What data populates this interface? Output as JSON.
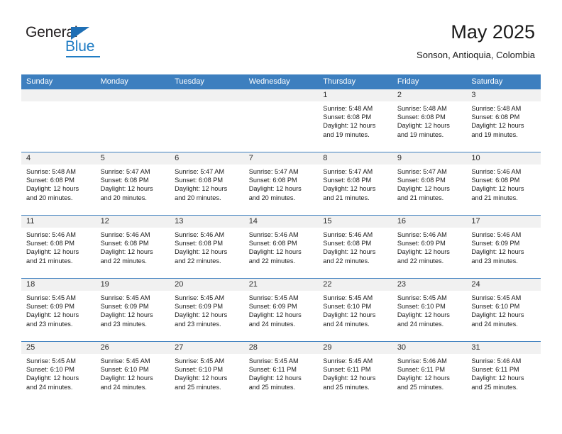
{
  "brand": {
    "name_part1": "General",
    "name_part2": "Blue",
    "accent_color": "#1f7cc4"
  },
  "header": {
    "title": "May 2025",
    "subtitle": "Sonson, Antioquia, Colombia"
  },
  "calendar": {
    "header_bg": "#3d7fbf",
    "daynum_bg": "#f1f1f1",
    "weekdays": [
      "Sunday",
      "Monday",
      "Tuesday",
      "Wednesday",
      "Thursday",
      "Friday",
      "Saturday"
    ],
    "weeks": [
      [
        {
          "day": "",
          "lines": []
        },
        {
          "day": "",
          "lines": []
        },
        {
          "day": "",
          "lines": []
        },
        {
          "day": "",
          "lines": []
        },
        {
          "day": "1",
          "lines": [
            "Sunrise: 5:48 AM",
            "Sunset: 6:08 PM",
            "Daylight: 12 hours",
            "and 19 minutes."
          ]
        },
        {
          "day": "2",
          "lines": [
            "Sunrise: 5:48 AM",
            "Sunset: 6:08 PM",
            "Daylight: 12 hours",
            "and 19 minutes."
          ]
        },
        {
          "day": "3",
          "lines": [
            "Sunrise: 5:48 AM",
            "Sunset: 6:08 PM",
            "Daylight: 12 hours",
            "and 19 minutes."
          ]
        }
      ],
      [
        {
          "day": "4",
          "lines": [
            "Sunrise: 5:48 AM",
            "Sunset: 6:08 PM",
            "Daylight: 12 hours",
            "and 20 minutes."
          ]
        },
        {
          "day": "5",
          "lines": [
            "Sunrise: 5:47 AM",
            "Sunset: 6:08 PM",
            "Daylight: 12 hours",
            "and 20 minutes."
          ]
        },
        {
          "day": "6",
          "lines": [
            "Sunrise: 5:47 AM",
            "Sunset: 6:08 PM",
            "Daylight: 12 hours",
            "and 20 minutes."
          ]
        },
        {
          "day": "7",
          "lines": [
            "Sunrise: 5:47 AM",
            "Sunset: 6:08 PM",
            "Daylight: 12 hours",
            "and 20 minutes."
          ]
        },
        {
          "day": "8",
          "lines": [
            "Sunrise: 5:47 AM",
            "Sunset: 6:08 PM",
            "Daylight: 12 hours",
            "and 21 minutes."
          ]
        },
        {
          "day": "9",
          "lines": [
            "Sunrise: 5:47 AM",
            "Sunset: 6:08 PM",
            "Daylight: 12 hours",
            "and 21 minutes."
          ]
        },
        {
          "day": "10",
          "lines": [
            "Sunrise: 5:46 AM",
            "Sunset: 6:08 PM",
            "Daylight: 12 hours",
            "and 21 minutes."
          ]
        }
      ],
      [
        {
          "day": "11",
          "lines": [
            "Sunrise: 5:46 AM",
            "Sunset: 6:08 PM",
            "Daylight: 12 hours",
            "and 21 minutes."
          ]
        },
        {
          "day": "12",
          "lines": [
            "Sunrise: 5:46 AM",
            "Sunset: 6:08 PM",
            "Daylight: 12 hours",
            "and 22 minutes."
          ]
        },
        {
          "day": "13",
          "lines": [
            "Sunrise: 5:46 AM",
            "Sunset: 6:08 PM",
            "Daylight: 12 hours",
            "and 22 minutes."
          ]
        },
        {
          "day": "14",
          "lines": [
            "Sunrise: 5:46 AM",
            "Sunset: 6:08 PM",
            "Daylight: 12 hours",
            "and 22 minutes."
          ]
        },
        {
          "day": "15",
          "lines": [
            "Sunrise: 5:46 AM",
            "Sunset: 6:08 PM",
            "Daylight: 12 hours",
            "and 22 minutes."
          ]
        },
        {
          "day": "16",
          "lines": [
            "Sunrise: 5:46 AM",
            "Sunset: 6:09 PM",
            "Daylight: 12 hours",
            "and 22 minutes."
          ]
        },
        {
          "day": "17",
          "lines": [
            "Sunrise: 5:46 AM",
            "Sunset: 6:09 PM",
            "Daylight: 12 hours",
            "and 23 minutes."
          ]
        }
      ],
      [
        {
          "day": "18",
          "lines": [
            "Sunrise: 5:45 AM",
            "Sunset: 6:09 PM",
            "Daylight: 12 hours",
            "and 23 minutes."
          ]
        },
        {
          "day": "19",
          "lines": [
            "Sunrise: 5:45 AM",
            "Sunset: 6:09 PM",
            "Daylight: 12 hours",
            "and 23 minutes."
          ]
        },
        {
          "day": "20",
          "lines": [
            "Sunrise: 5:45 AM",
            "Sunset: 6:09 PM",
            "Daylight: 12 hours",
            "and 23 minutes."
          ]
        },
        {
          "day": "21",
          "lines": [
            "Sunrise: 5:45 AM",
            "Sunset: 6:09 PM",
            "Daylight: 12 hours",
            "and 24 minutes."
          ]
        },
        {
          "day": "22",
          "lines": [
            "Sunrise: 5:45 AM",
            "Sunset: 6:10 PM",
            "Daylight: 12 hours",
            "and 24 minutes."
          ]
        },
        {
          "day": "23",
          "lines": [
            "Sunrise: 5:45 AM",
            "Sunset: 6:10 PM",
            "Daylight: 12 hours",
            "and 24 minutes."
          ]
        },
        {
          "day": "24",
          "lines": [
            "Sunrise: 5:45 AM",
            "Sunset: 6:10 PM",
            "Daylight: 12 hours",
            "and 24 minutes."
          ]
        }
      ],
      [
        {
          "day": "25",
          "lines": [
            "Sunrise: 5:45 AM",
            "Sunset: 6:10 PM",
            "Daylight: 12 hours",
            "and 24 minutes."
          ]
        },
        {
          "day": "26",
          "lines": [
            "Sunrise: 5:45 AM",
            "Sunset: 6:10 PM",
            "Daylight: 12 hours",
            "and 24 minutes."
          ]
        },
        {
          "day": "27",
          "lines": [
            "Sunrise: 5:45 AM",
            "Sunset: 6:10 PM",
            "Daylight: 12 hours",
            "and 25 minutes."
          ]
        },
        {
          "day": "28",
          "lines": [
            "Sunrise: 5:45 AM",
            "Sunset: 6:11 PM",
            "Daylight: 12 hours",
            "and 25 minutes."
          ]
        },
        {
          "day": "29",
          "lines": [
            "Sunrise: 5:45 AM",
            "Sunset: 6:11 PM",
            "Daylight: 12 hours",
            "and 25 minutes."
          ]
        },
        {
          "day": "30",
          "lines": [
            "Sunrise: 5:46 AM",
            "Sunset: 6:11 PM",
            "Daylight: 12 hours",
            "and 25 minutes."
          ]
        },
        {
          "day": "31",
          "lines": [
            "Sunrise: 5:46 AM",
            "Sunset: 6:11 PM",
            "Daylight: 12 hours",
            "and 25 minutes."
          ]
        }
      ]
    ]
  }
}
